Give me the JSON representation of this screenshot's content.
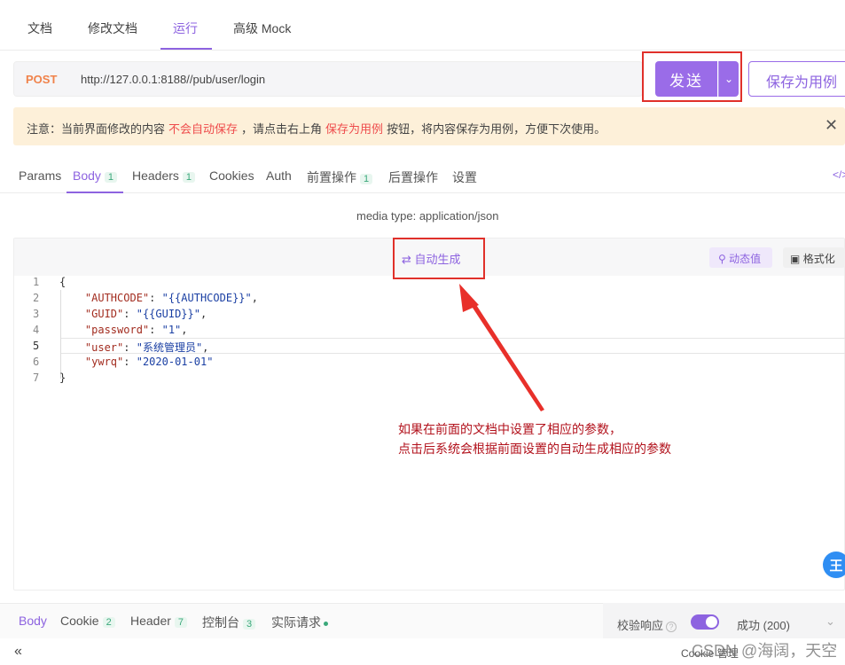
{
  "top_tabs": {
    "doc": "文档",
    "edit_doc": "修改文档",
    "run": "运行",
    "mock": "高级 Mock"
  },
  "request": {
    "method": "POST",
    "url": "http://127.0.0.1:8188//pub/user/login",
    "send_label": "发送",
    "save_as_label": "保存为用例"
  },
  "notice": {
    "prefix": "注意：当前界面修改的内容",
    "highlight1": "不会自动保存",
    "middle": "，请点击右上角",
    "highlight2": "保存为用例",
    "suffix": "按钮，将内容保存为用例，方便下次使用。"
  },
  "req_tabs": {
    "params": "Params",
    "body": "Body",
    "body_count": "1",
    "headers": "Headers",
    "headers_count": "1",
    "cookies": "Cookies",
    "auth": "Auth",
    "pre": "前置操作",
    "pre_count": "1",
    "post": "后置操作",
    "settings": "设置",
    "code_toggle": "</>"
  },
  "media_type": "media type: application/json",
  "editor": {
    "autogen": "自动生成",
    "dynamic": "动态值",
    "format": "格式化",
    "lines": [
      {
        "n": "1",
        "code": "{"
      },
      {
        "n": "2",
        "key": "\"AUTHCODE\"",
        "val": "\"{{AUTHCODE}}\"",
        "end": ","
      },
      {
        "n": "3",
        "key": "\"GUID\"",
        "val": "\"{{GUID}}\"",
        "end": ","
      },
      {
        "n": "4",
        "key": "\"password\"",
        "val": "\"1\"",
        "end": ","
      },
      {
        "n": "5",
        "key": "\"user\"",
        "val": "\"系统管理员\"",
        "end": ","
      },
      {
        "n": "6",
        "key": "\"ywrq\"",
        "val": "\"2020-01-01\"",
        "end": ""
      },
      {
        "n": "7",
        "code": "}"
      }
    ]
  },
  "annotation": {
    "line1": "如果在前面的文档中设置了相应的参数，",
    "line2": "点击后系统会根据前面设置的自动生成相应的参数"
  },
  "response": {
    "body": "Body",
    "cookie": "Cookie",
    "cookie_count": "2",
    "header": "Header",
    "header_count": "7",
    "console": "控制台",
    "console_count": "3",
    "actual": "实际请求",
    "validate": "校验响应",
    "status": "成功 (200)"
  },
  "footer": {
    "collapse": "«",
    "cookie_mgr": "Cookie 管理",
    "watermark": "CSDN @海阔，天空"
  },
  "colors": {
    "accent": "#8d63e0",
    "method": "#f0824a",
    "highlight": "#e0302a",
    "annotation": "#b2121c"
  }
}
